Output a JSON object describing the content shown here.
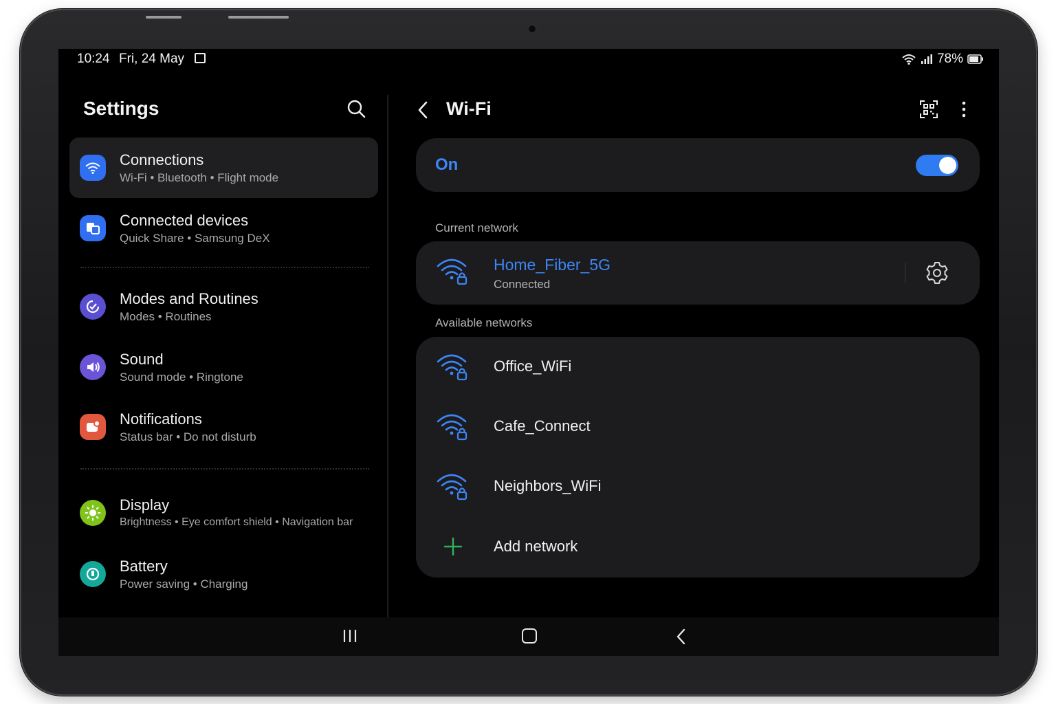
{
  "status_bar": {
    "time": "10:24",
    "date": "Fri, 24 May",
    "battery": "78%",
    "icons": [
      "gallery-icon",
      "wifi-signal-icon",
      "cell-signal-icon",
      "battery-icon"
    ]
  },
  "settings": {
    "title": "Settings",
    "items": [
      {
        "label": "Connections",
        "sub": "Wi-Fi  •  Bluetooth  •  Flight mode",
        "icon": "wifi-icon",
        "color": "#2f6ff0",
        "selected": true
      },
      {
        "label": "Connected devices",
        "sub": "Quick Share  •  Samsung DeX",
        "icon": "devices-icon",
        "color": "#2f6ff0"
      },
      {
        "label": "Modes and Routines",
        "sub": "Modes  •  Routines",
        "icon": "routines-icon",
        "color": "#5b4fd1"
      },
      {
        "label": "Sound",
        "sub": "Sound mode  •  Ringtone",
        "icon": "speaker-icon",
        "color": "#6b54d8"
      },
      {
        "label": "Notifications",
        "sub": "Status bar  •  Do not disturb",
        "icon": "notification-icon",
        "color": "#e2583e"
      },
      {
        "label": "Display",
        "sub": "Brightness  •  Eye comfort shield  •  Navigation bar",
        "icon": "sun-icon",
        "color": "#7fc31b"
      },
      {
        "label": "Battery",
        "sub": "Power saving  •  Charging",
        "icon": "battery-circle-icon",
        "color": "#13a89a"
      }
    ]
  },
  "wifi": {
    "title": "Wi-Fi",
    "toggle_label": "On",
    "toggle_on": true,
    "accent": "#3d86f6",
    "current_label": "Current network",
    "current": {
      "name": "Home_Fiber_5G",
      "status": "Connected"
    },
    "available_label": "Available networks",
    "networks": [
      {
        "name": "Office_WiFi"
      },
      {
        "name": "Cafe_Connect"
      },
      {
        "name": "Neighbors_WiFi"
      }
    ],
    "add_label": "Add network",
    "add_color": "#2fb35a"
  }
}
